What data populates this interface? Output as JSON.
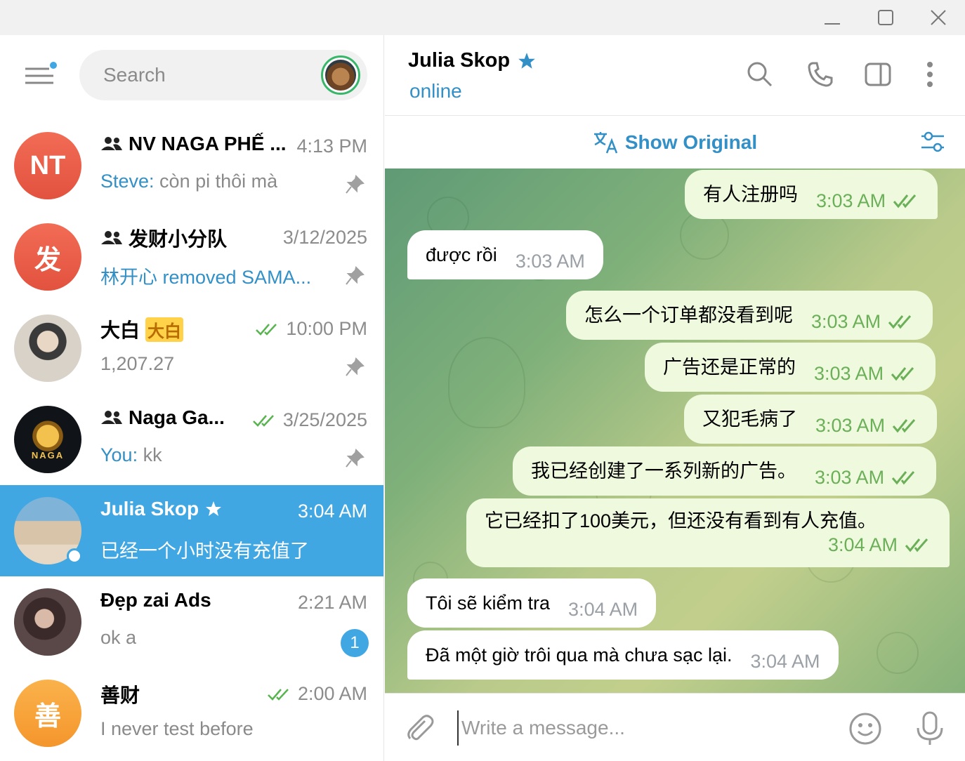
{
  "window": {
    "minimize": "minimize",
    "maximize": "maximize",
    "close": "close"
  },
  "sidebar": {
    "search_placeholder": "Search",
    "chats": [
      {
        "initials": "NT",
        "name": "NV NAGA PHẾ ...",
        "time": "4:13 PM",
        "sender": "Steve:",
        "preview": " còn pi thôi mà",
        "group": true,
        "pinned": true,
        "avatar_color": "#ee5f48"
      },
      {
        "initials": "发",
        "name": "发财小分队",
        "time": "3/12/2025",
        "sender": "",
        "preview": "林开心 removed SAMA...",
        "preview_blue": true,
        "group": true,
        "pinned": true,
        "avatar_color": "#ee5f48"
      },
      {
        "initials": "",
        "name": "大白",
        "name_badge": "大白",
        "time": "10:00 PM",
        "sender": "",
        "preview": "1,207.27",
        "read": true,
        "pinned": true
      },
      {
        "initials": "",
        "name": "Naga Ga...",
        "time": "3/25/2025",
        "sender": "You:",
        "preview": " kk",
        "group": true,
        "read": true,
        "pinned": true
      },
      {
        "initials": "",
        "name": "Julia Skop",
        "time": "3:04 AM",
        "sender": "",
        "preview": "已经一个小时没有充值了",
        "active": true,
        "online": true
      },
      {
        "initials": "",
        "name": "Đẹp zai Ads",
        "time": "2:21 AM",
        "sender": "",
        "preview": "ok a",
        "unread": "1"
      },
      {
        "initials": "善",
        "name": "善财",
        "time": "2:00 AM",
        "sender": "",
        "preview": "I never test before",
        "read": true,
        "avatar_color": "#f7a43b"
      }
    ]
  },
  "header": {
    "name": "Julia Skop",
    "status": "online"
  },
  "translate": {
    "label": "Show Original"
  },
  "messages": [
    {
      "dir": "out",
      "text": "有人注册吗",
      "time": "3:03 AM"
    },
    {
      "dir": "in",
      "text": "được rồi",
      "time": "3:03 AM"
    },
    {
      "dir": "out",
      "text": "怎么一个订单都没看到呢",
      "time": "3:03 AM"
    },
    {
      "dir": "out",
      "text": "广告还是正常的",
      "time": "3:03 AM"
    },
    {
      "dir": "out",
      "text": "又犯毛病了",
      "time": "3:03 AM"
    },
    {
      "dir": "out",
      "text": "我已经创建了一系列新的广告。",
      "time": "3:03 AM"
    },
    {
      "dir": "out",
      "text": "它已经扣了100美元，但还没有看到有人充值。",
      "time": "3:04 AM"
    },
    {
      "dir": "in",
      "text": "Tôi sẽ kiểm tra",
      "time": "3:04 AM"
    },
    {
      "dir": "in",
      "text": "Đã một giờ trôi qua mà chưa sạc lại.",
      "time": "3:04 AM"
    }
  ],
  "composer": {
    "placeholder": "Write a message..."
  },
  "colors": {
    "accent": "#40a7e3",
    "link": "#3390c7",
    "out_bubble": "#eff9de",
    "check": "#6bb059"
  }
}
